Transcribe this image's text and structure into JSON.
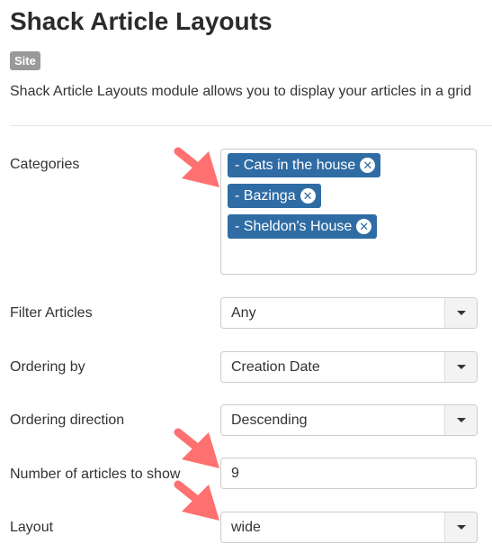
{
  "header": {
    "title": "Shack Article Layouts",
    "badge": "Site",
    "description": "Shack Article Layouts module allows you to display your articles in a grid"
  },
  "form": {
    "categories": {
      "label": "Categories",
      "selected": [
        "- Cats in the house",
        "- Bazinga",
        "- Sheldon's House"
      ],
      "remove_icon": "remove-circle-icon"
    },
    "filter_articles": {
      "label": "Filter Articles",
      "value": "Any"
    },
    "ordering_by": {
      "label": "Ordering by",
      "value": "Creation Date"
    },
    "ordering_direction": {
      "label": "Ordering direction",
      "value": "Descending"
    },
    "number_of_articles": {
      "label": "Number of articles to show",
      "value": "9"
    },
    "layout": {
      "label": "Layout",
      "value": "wide"
    }
  },
  "annotations": {
    "arrow_color": "#ff6b6b",
    "arrows": [
      "categories",
      "number_of_articles",
      "layout"
    ]
  },
  "colors": {
    "chip_bg": "#2f6ca4",
    "badge_bg": "#999999"
  }
}
